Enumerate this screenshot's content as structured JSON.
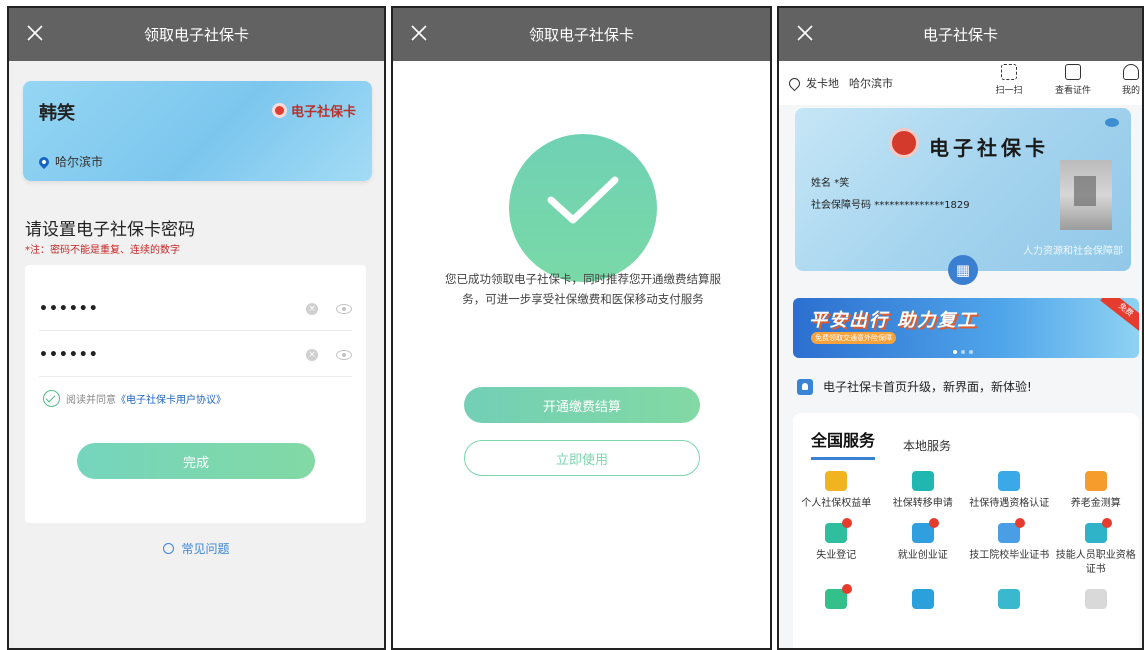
{
  "screen1": {
    "title": "领取电子社保卡",
    "card": {
      "name": "韩笑",
      "brand": "电子社保卡",
      "location": "哈尔滨市"
    },
    "password_title": "请设置电子社保卡密码",
    "password_note": "*注：密码不能是重复、连续的数字",
    "password_value": "••••••",
    "password_confirm_value": "••••••",
    "agree_text": "阅读并同意",
    "agreement_link": "《电子社保卡用户协议》",
    "submit_label": "完成",
    "faq_label": "常见问题"
  },
  "screen2": {
    "title": "领取电子社保卡",
    "message": "您已成功领取电子社保卡，同时推荐您开通缴费结算服务，可进一步享受社保缴费和医保移动支付服务",
    "primary_button": "开通缴费结算",
    "secondary_button": "立即使用"
  },
  "screen3": {
    "title": "电子社保卡",
    "location_label": "发卡地",
    "location_city": "哈尔滨市",
    "tools": [
      {
        "label": "扫一扫",
        "icon": "scan-icon"
      },
      {
        "label": "查看证件",
        "icon": "id-card-icon"
      },
      {
        "label": "我的",
        "icon": "user-icon"
      }
    ],
    "card": {
      "title": "电子社保卡",
      "name_label": "姓名",
      "name_value": "*笑",
      "number_label": "社会保障号码",
      "number_value": "**************1829",
      "issuer": "人力资源和社会保障部"
    },
    "banner": {
      "headline": "平安出行 助力复工",
      "subline": "免费领取交通意外险保障",
      "tag": "免费"
    },
    "notice": "电子社保卡首页升级，新界面，新体验!",
    "tabs": [
      "全国服务",
      "本地服务"
    ],
    "services": [
      {
        "label": "个人社保权益单",
        "color": "#f2b321",
        "badge": false
      },
      {
        "label": "社保转移申请",
        "color": "#1fb7b0",
        "badge": false
      },
      {
        "label": "社保待遇资格认证",
        "color": "#39a9e8",
        "badge": false
      },
      {
        "label": "养老金测算",
        "color": "#f59c2c",
        "badge": false
      },
      {
        "label": "失业登记",
        "color": "#2fbf9f",
        "badge": true
      },
      {
        "label": "就业创业证",
        "color": "#2f9fe0",
        "badge": true
      },
      {
        "label": "技工院校毕业证书",
        "color": "#4a9ee6",
        "badge": true
      },
      {
        "label": "技能人员职业资格证书",
        "color": "#2eb3c8",
        "badge": true
      },
      {
        "label": "",
        "color": "#33c08a",
        "badge": true
      },
      {
        "label": "",
        "color": "#2aa0dc",
        "badge": false
      },
      {
        "label": "",
        "color": "#3ab9ce",
        "badge": false
      },
      {
        "label": "",
        "color": "#d9d9d9",
        "badge": false
      }
    ]
  }
}
